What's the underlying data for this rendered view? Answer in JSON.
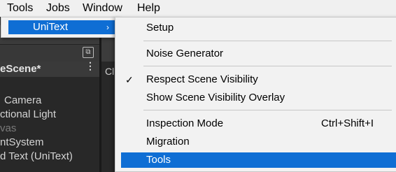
{
  "menubar": {
    "items": [
      "Tools",
      "Jobs",
      "Window",
      "Help"
    ]
  },
  "hierarchy": {
    "scene_title": "eScene*",
    "items": [
      "Camera",
      "ctional Light",
      "vas",
      "ntSystem",
      "d Text (UniText)"
    ]
  },
  "scene_view": {
    "tab_hash": "#",
    "tab_label": "Cl"
  },
  "tools_menu": {
    "items": [
      {
        "label": "UniText",
        "arrow": "›"
      }
    ]
  },
  "unitext_menu": {
    "items": [
      {
        "label": "Setup"
      },
      {
        "label": "Noise Generator"
      },
      {
        "label": "Respect Scene Visibility",
        "checked": true,
        "check": "✓"
      },
      {
        "label": "Show Scene Visibility Overlay"
      },
      {
        "label": "Inspection Mode",
        "shortcut": "Ctrl+Shift+I"
      },
      {
        "label": "Migration"
      },
      {
        "label": "Tools"
      }
    ]
  },
  "colors": {
    "highlight": "#0f6ed4",
    "menu_bg": "#f2f2f2",
    "editor_bg": "#282828"
  }
}
